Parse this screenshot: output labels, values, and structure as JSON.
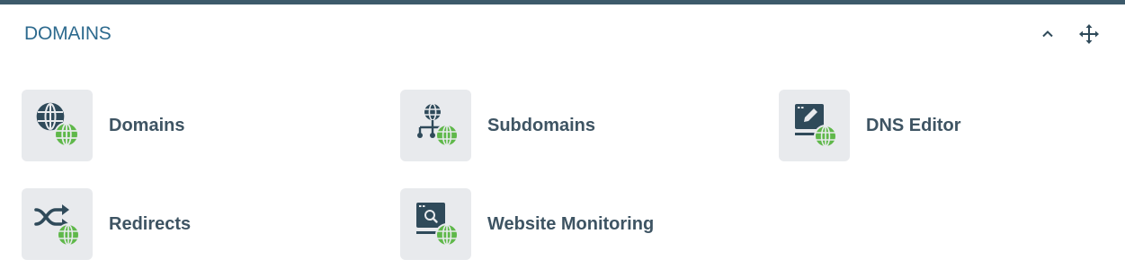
{
  "panel": {
    "title": "DOMAINS",
    "collapse_icon": "chevron-up-icon",
    "move_icon": "move-arrows-icon",
    "accent_color": "#3d5a6b",
    "title_color": "#2d6a8e"
  },
  "tiles": [
    {
      "label": "Domains",
      "icon": "domains-globe-icon"
    },
    {
      "label": "Subdomains",
      "icon": "subdomains-network-icon"
    },
    {
      "label": "DNS Editor",
      "icon": "dns-editor-icon"
    },
    {
      "label": "Redirects",
      "icon": "redirects-shuffle-icon"
    },
    {
      "label": "Website Monitoring",
      "icon": "website-monitoring-icon"
    }
  ],
  "colors": {
    "icon_dark": "#2f4a5a",
    "globe_green": "#5fb84a",
    "tile_bg": "#e8eaed",
    "label": "#3e5463"
  }
}
